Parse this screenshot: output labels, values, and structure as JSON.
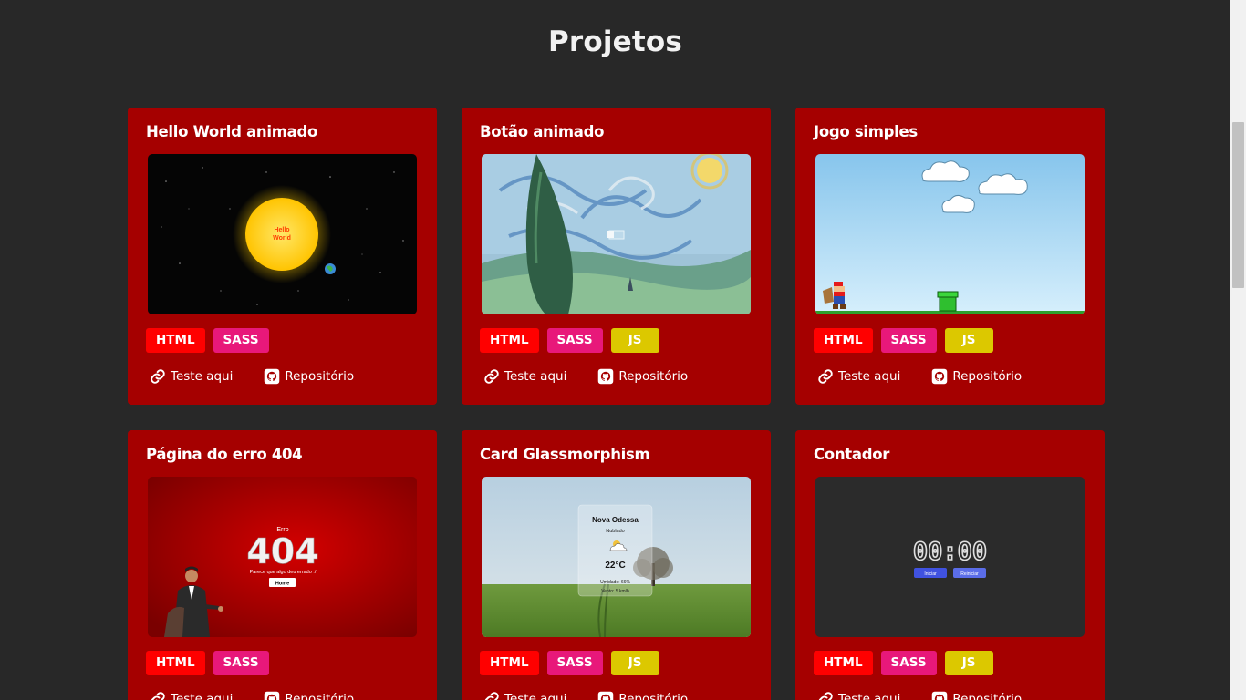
{
  "page": {
    "title": "Projetos"
  },
  "link_labels": {
    "test": "Teste aqui",
    "repo": "Repositório"
  },
  "projects": [
    {
      "title": "Hello World animado",
      "tags": [
        "HTML",
        "SASS"
      ],
      "preview": {
        "sun_text_1": "Hello",
        "sun_text_2": "World"
      }
    },
    {
      "title": "Botão animado",
      "tags": [
        "HTML",
        "SASS",
        "JS"
      ]
    },
    {
      "title": "Jogo simples",
      "tags": [
        "HTML",
        "SASS",
        "JS"
      ]
    },
    {
      "title": "Página do erro 404",
      "tags": [
        "HTML",
        "SASS"
      ],
      "preview": {
        "label": "Erro",
        "code": "404",
        "message": "Parece que algo deu errado :/",
        "button": "Home"
      }
    },
    {
      "title": "Card Glassmorphism",
      "tags": [
        "HTML",
        "SASS",
        "JS"
      ],
      "preview": {
        "city": "Nova Odessa",
        "condition": "Nublado",
        "temp": "22°C",
        "humidity": "Umidade: 66%",
        "wind": "Vento: 5 km/h"
      }
    },
    {
      "title": "Contador",
      "tags": [
        "HTML",
        "SASS",
        "JS"
      ],
      "preview": {
        "time": "00:00",
        "start": "Iniciar",
        "reset": "Reiniciar"
      }
    }
  ],
  "colors": {
    "background": "#282828",
    "card": "#a50000",
    "html_tag": "#ff0000",
    "sass_tag": "#e8187a",
    "js_tag": "#dcc800"
  }
}
